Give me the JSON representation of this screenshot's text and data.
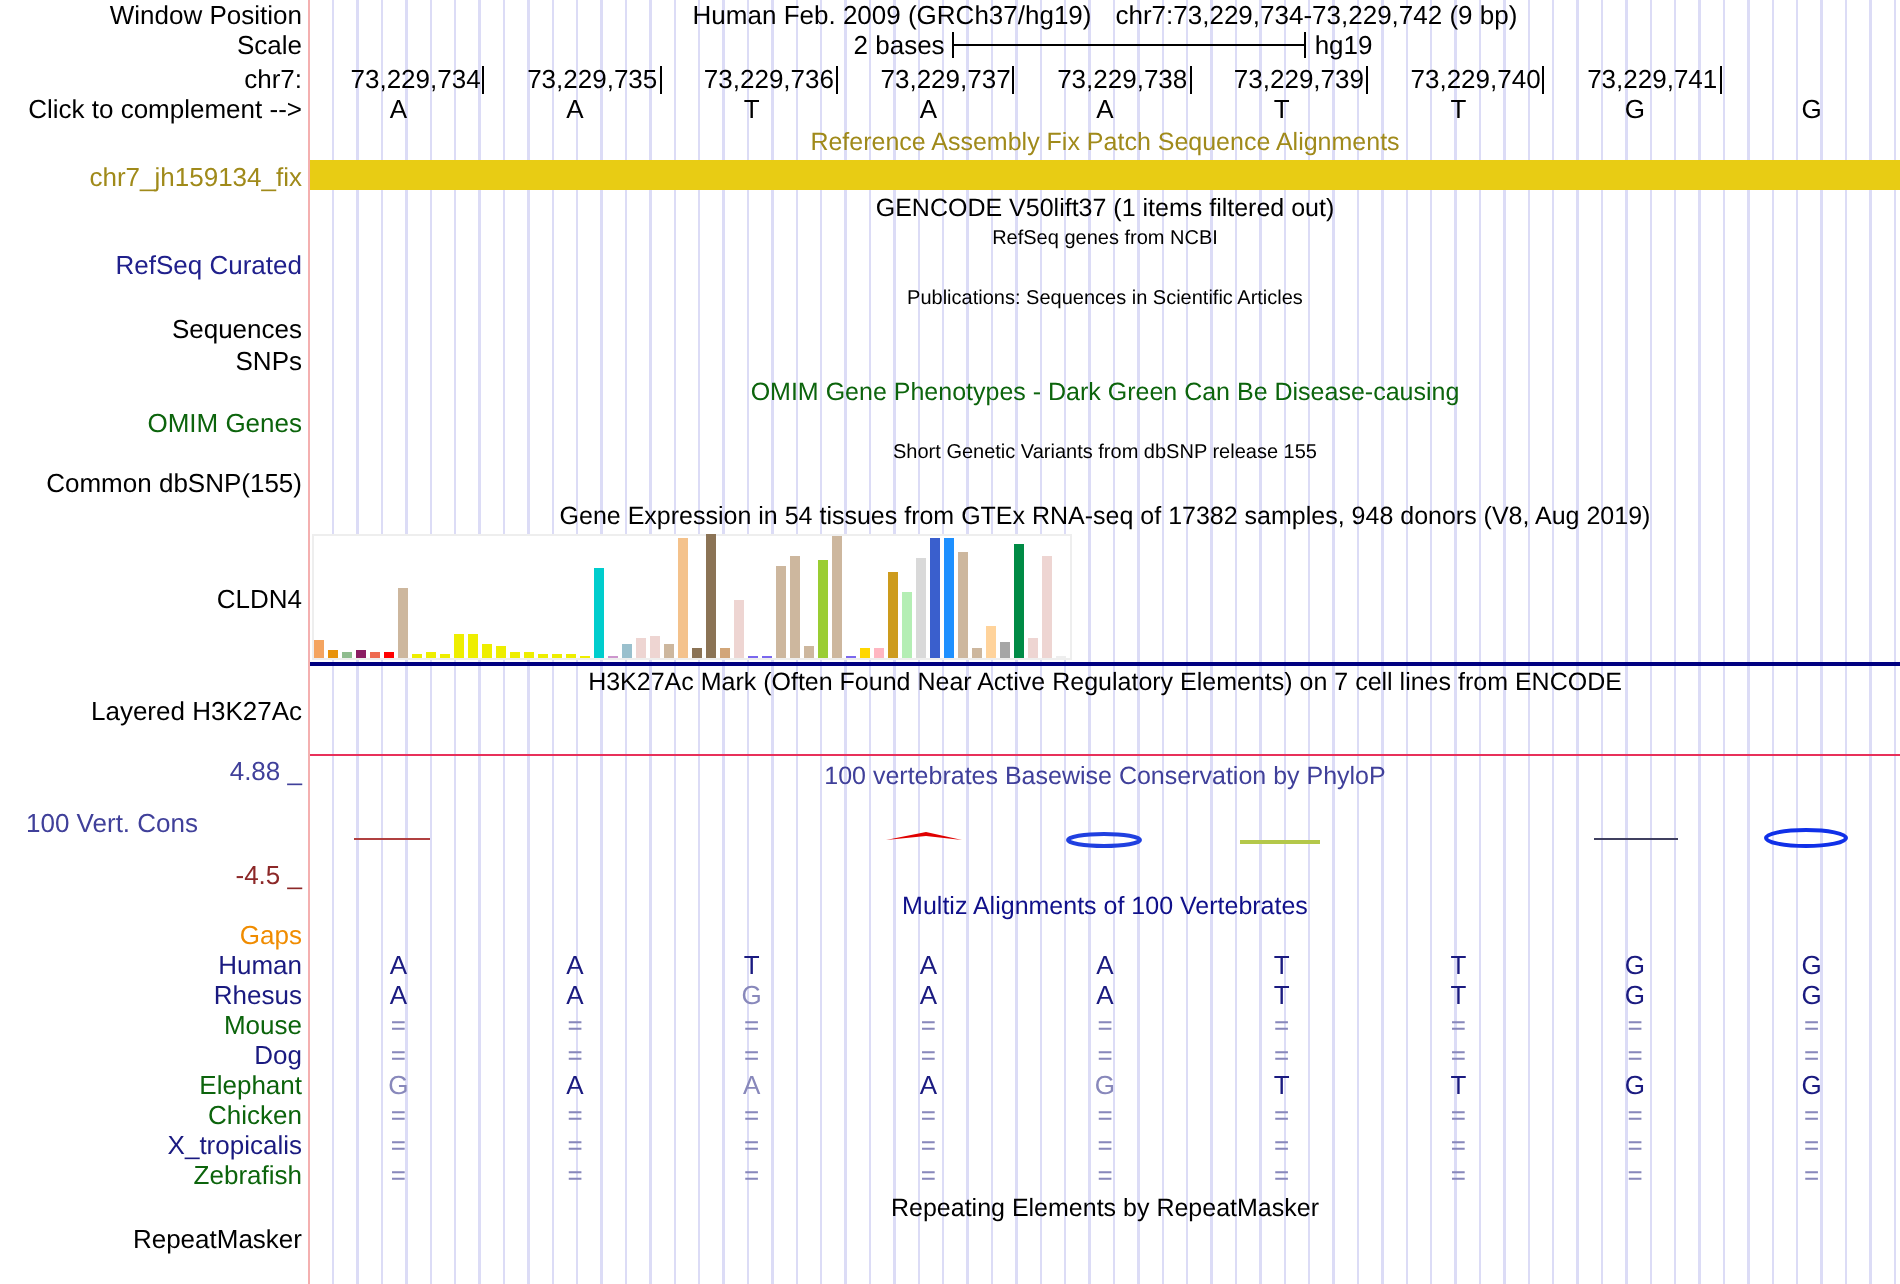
{
  "header": {
    "label": "Window Position",
    "assembly": "Human Feb. 2009 (GRCh37/hg19)",
    "position": "chr7:73,229,734-73,229,742 (9 bp)"
  },
  "scale": {
    "label": "Scale",
    "text": "2 bases",
    "assembly": "hg19"
  },
  "ruler": {
    "label": "chr7:",
    "positions": [
      "73,229,734",
      "73,229,735",
      "73,229,736",
      "73,229,737",
      "73,229,738",
      "73,229,739",
      "73,229,740",
      "73,229,741"
    ]
  },
  "sequence": {
    "label": "Click to complement -->",
    "bases": [
      "A",
      "A",
      "T",
      "A",
      "A",
      "T",
      "T",
      "G",
      "G"
    ]
  },
  "tracks": [
    {
      "kind": "bar",
      "title": "Reference Assembly Fix Patch Sequence Alignments",
      "labels": [
        "chr7_jh159134_fix"
      ],
      "color": "#a08a1a"
    },
    {
      "kind": "gene",
      "title": "GENCODE V50lift37 (1 items filtered out)",
      "subtitle": "RefSeq genes from NCBI",
      "labels": [
        "RefSeq Curated"
      ],
      "color": "#20208c"
    },
    {
      "kind": "plain",
      "small": true,
      "title": "Publications: Sequences in Scientific Articles",
      "labels": [
        "Sequences",
        "SNPs"
      ],
      "color": "#000000"
    },
    {
      "kind": "plain",
      "small": false,
      "title": "OMIM Gene Phenotypes - Dark Green Can Be Disease-causing",
      "labels": [
        "OMIM Genes"
      ],
      "color": "#0c640c"
    },
    {
      "kind": "plain",
      "small": true,
      "title": "Short Genetic Variants from dbSNP release 155",
      "labels": [
        "Common dbSNP(155)"
      ],
      "color": "#000000"
    },
    {
      "kind": "expression",
      "title": "Gene Expression in 54 tissues from GTEx RNA-seq of 17382 samples, 948 donors (V8, Aug 2019)",
      "labels": [
        "CLDN4"
      ],
      "color": "#000000"
    },
    {
      "kind": "layered",
      "title": "H3K27Ac Mark (Often Found Near Active Regulatory Elements) on 7 cell lines from ENCODE",
      "labels": [
        "Layered H3K27Ac"
      ],
      "color": "#000000"
    },
    {
      "kind": "conservation",
      "title": "100 vertebrates Basewise Conservation by PhyloP",
      "labels": [
        "100 Vert. Cons"
      ],
      "max": "4.88 _",
      "min": "-4.5 _",
      "color": "#40409a"
    },
    {
      "kind": "plain",
      "small": false,
      "title": "Repeating Elements by RepeatMasker",
      "labels": [
        "RepeatMasker"
      ],
      "color": "#000000"
    }
  ],
  "multiz": {
    "title": "Multiz Alignments of 100 Vertebrates",
    "gaps_label": "Gaps",
    "species": [
      {
        "name": "Human",
        "color": "#1a1a80",
        "cells": [
          {
            "b": "A",
            "dim": false
          },
          {
            "b": "A",
            "dim": false
          },
          {
            "b": "T",
            "dim": false
          },
          {
            "b": "A",
            "dim": false
          },
          {
            "b": "A",
            "dim": false
          },
          {
            "b": "T",
            "dim": false
          },
          {
            "b": "T",
            "dim": false
          },
          {
            "b": "G",
            "dim": false
          },
          {
            "b": "G",
            "dim": false
          }
        ]
      },
      {
        "name": "Rhesus",
        "color": "#1a1a80",
        "cells": [
          {
            "b": "A",
            "dim": false
          },
          {
            "b": "A",
            "dim": false
          },
          {
            "b": "G",
            "dim": true
          },
          {
            "b": "A",
            "dim": false
          },
          {
            "b": "A",
            "dim": false
          },
          {
            "b": "T",
            "dim": false
          },
          {
            "b": "T",
            "dim": false
          },
          {
            "b": "G",
            "dim": false
          },
          {
            "b": "G",
            "dim": false
          }
        ]
      },
      {
        "name": "Mouse",
        "color": "#0c640c",
        "cells": [
          {
            "b": "=",
            "dim": true
          },
          {
            "b": "=",
            "dim": true
          },
          {
            "b": "=",
            "dim": true
          },
          {
            "b": "=",
            "dim": true
          },
          {
            "b": "=",
            "dim": true
          },
          {
            "b": "=",
            "dim": true
          },
          {
            "b": "=",
            "dim": true
          },
          {
            "b": "=",
            "dim": true
          },
          {
            "b": "=",
            "dim": true
          }
        ]
      },
      {
        "name": "Dog",
        "color": "#1a1a80",
        "cells": [
          {
            "b": "=",
            "dim": true
          },
          {
            "b": "=",
            "dim": true
          },
          {
            "b": "=",
            "dim": true
          },
          {
            "b": "=",
            "dim": true
          },
          {
            "b": "=",
            "dim": true
          },
          {
            "b": "=",
            "dim": true
          },
          {
            "b": "=",
            "dim": true
          },
          {
            "b": "=",
            "dim": true
          },
          {
            "b": "=",
            "dim": true
          }
        ]
      },
      {
        "name": "Elephant",
        "color": "#0c640c",
        "cells": [
          {
            "b": "G",
            "dim": true
          },
          {
            "b": "A",
            "dim": false
          },
          {
            "b": "A",
            "dim": true
          },
          {
            "b": "A",
            "dim": false
          },
          {
            "b": "G",
            "dim": true
          },
          {
            "b": "T",
            "dim": false
          },
          {
            "b": "T",
            "dim": false
          },
          {
            "b": "G",
            "dim": false
          },
          {
            "b": "G",
            "dim": false
          }
        ]
      },
      {
        "name": "Chicken",
        "color": "#0c640c",
        "cells": [
          {
            "b": "=",
            "dim": true
          },
          {
            "b": "=",
            "dim": true
          },
          {
            "b": "=",
            "dim": true
          },
          {
            "b": "=",
            "dim": true
          },
          {
            "b": "=",
            "dim": true
          },
          {
            "b": "=",
            "dim": true
          },
          {
            "b": "=",
            "dim": true
          },
          {
            "b": "=",
            "dim": true
          },
          {
            "b": "=",
            "dim": true
          }
        ]
      },
      {
        "name": "X_tropicalis",
        "color": "#1a1a80",
        "cells": [
          {
            "b": "=",
            "dim": true
          },
          {
            "b": "=",
            "dim": true
          },
          {
            "b": "=",
            "dim": true
          },
          {
            "b": "=",
            "dim": true
          },
          {
            "b": "=",
            "dim": true
          },
          {
            "b": "=",
            "dim": true
          },
          {
            "b": "=",
            "dim": true
          },
          {
            "b": "=",
            "dim": true
          },
          {
            "b": "=",
            "dim": true
          }
        ]
      },
      {
        "name": "Zebrafish",
        "color": "#0c640c",
        "cells": [
          {
            "b": "=",
            "dim": true
          },
          {
            "b": "=",
            "dim": true
          },
          {
            "b": "=",
            "dim": true
          },
          {
            "b": "=",
            "dim": true
          },
          {
            "b": "=",
            "dim": true
          },
          {
            "b": "=",
            "dim": true
          },
          {
            "b": "=",
            "dim": true
          },
          {
            "b": "=",
            "dim": true
          },
          {
            "b": "=",
            "dim": true
          }
        ]
      }
    ]
  }
}
